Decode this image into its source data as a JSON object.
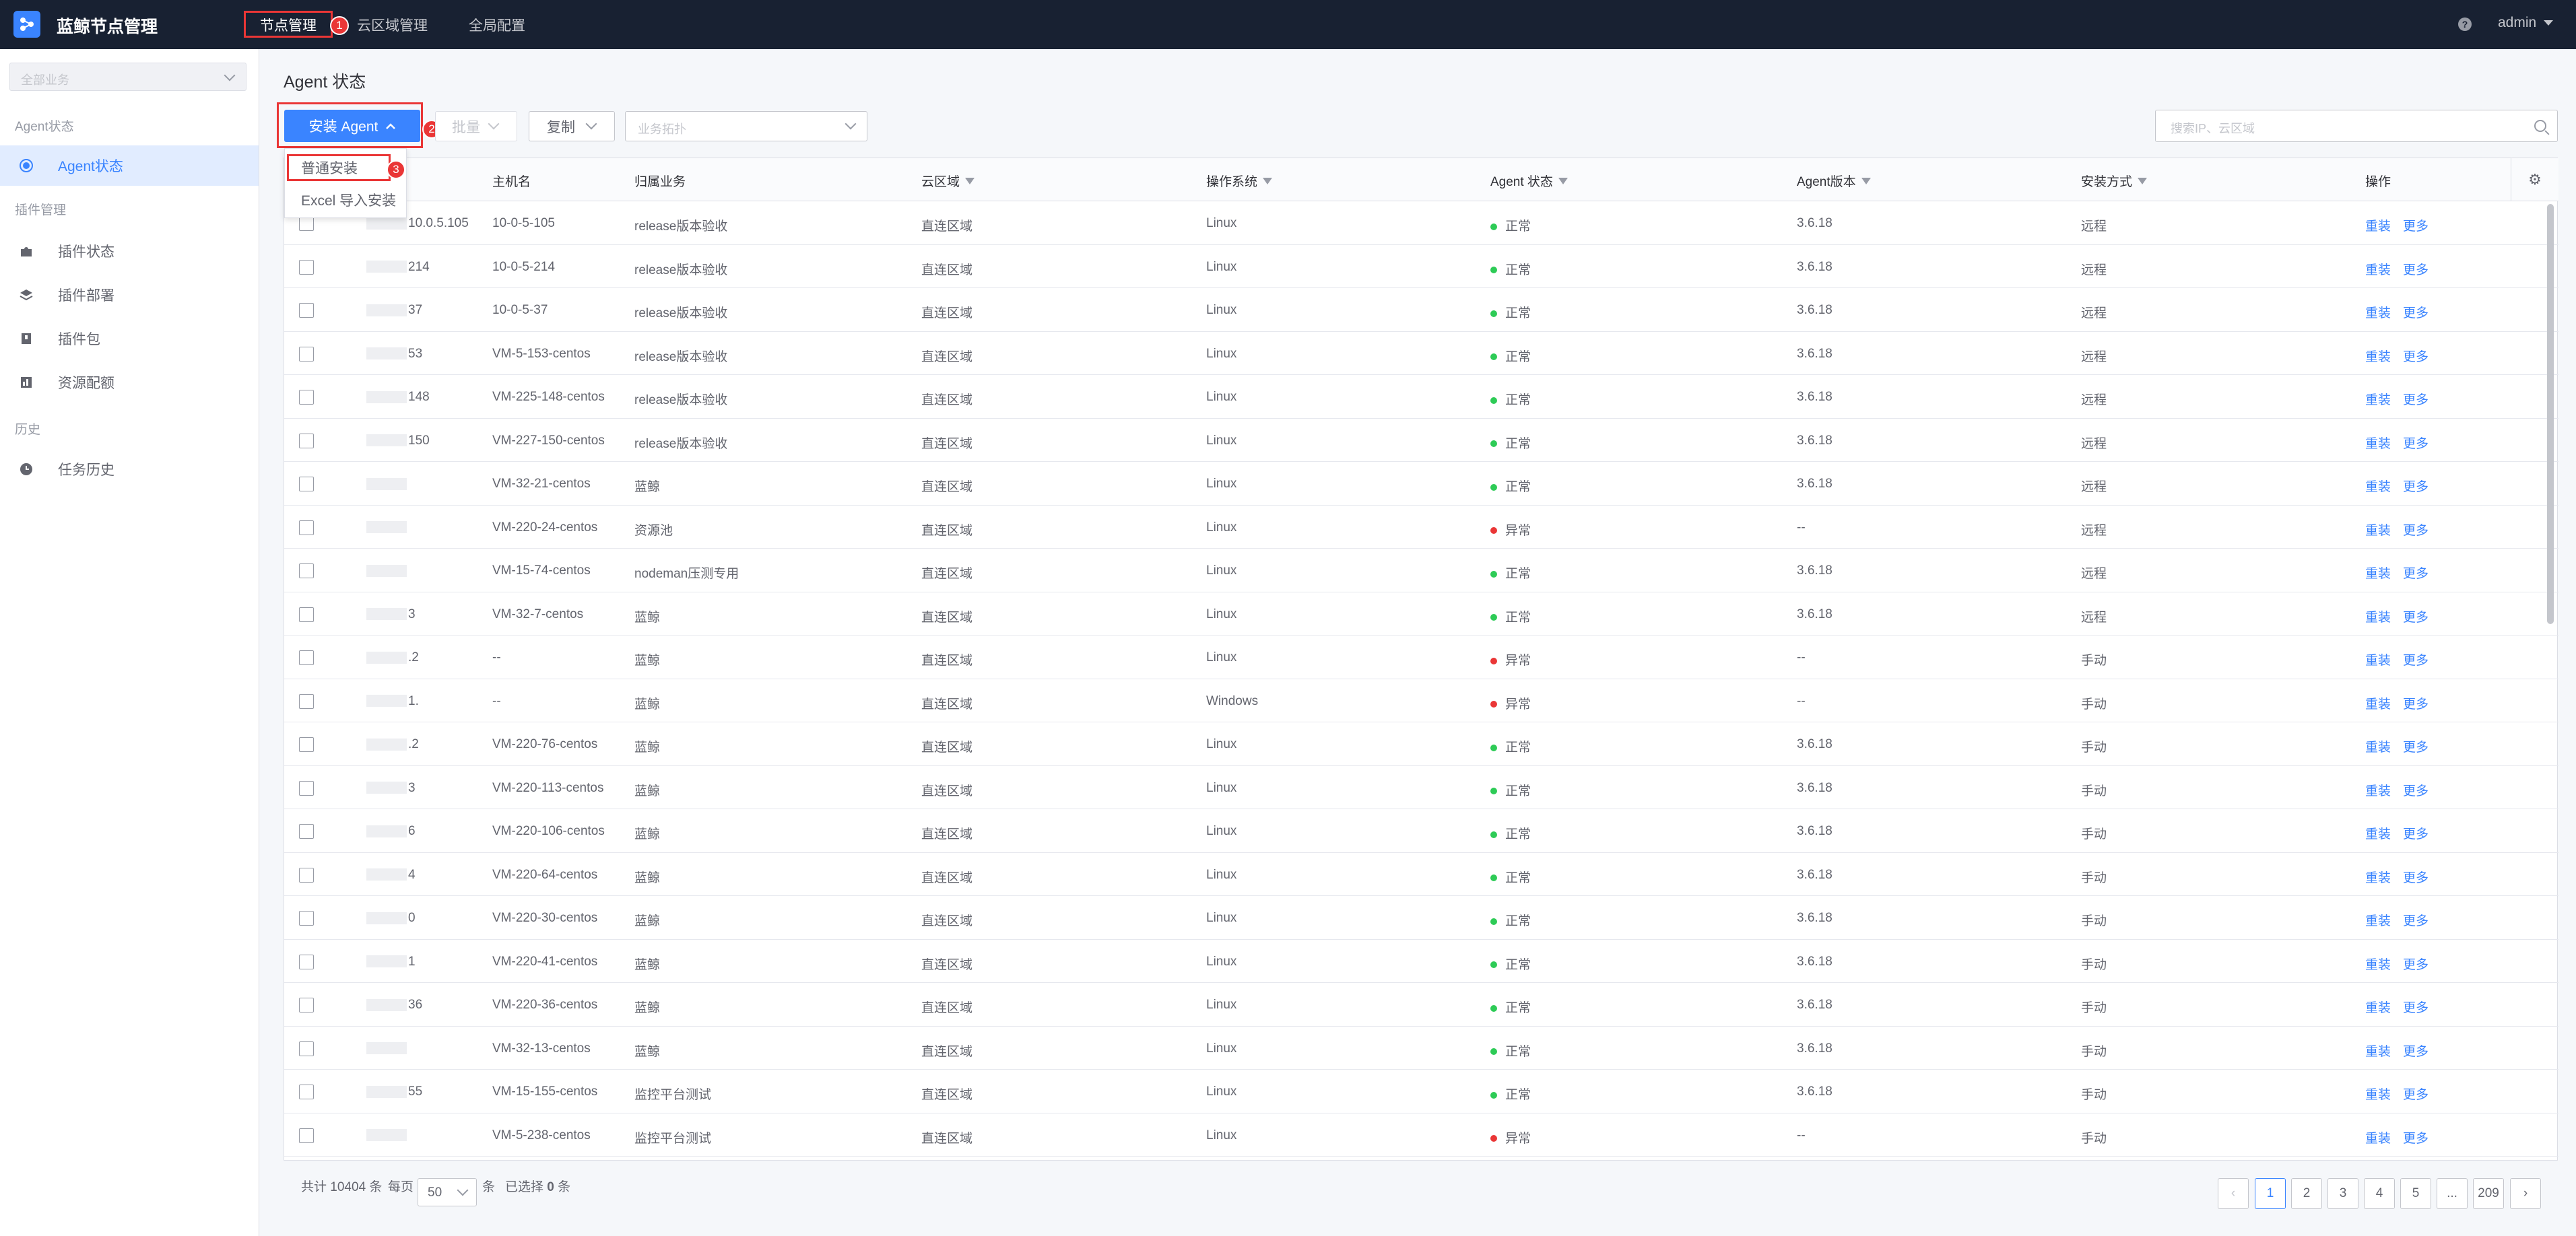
{
  "app": {
    "title": "蓝鲸节点管理"
  },
  "nav": {
    "items": [
      {
        "label": "节点管理"
      },
      {
        "label": "云区域管理"
      },
      {
        "label": "全局配置"
      }
    ],
    "user": "admin",
    "help": "?"
  },
  "annotations": {
    "b1": "1",
    "b2": "2",
    "b3": "3"
  },
  "sidebar": {
    "biz_placeholder": "全部业务",
    "group_agent": "Agent状态",
    "group_plugin": "插件管理",
    "group_history": "历史",
    "items": [
      {
        "label": "Agent状态",
        "icon": "radio-icon"
      },
      {
        "label": "插件状态",
        "icon": "puzzle-icon"
      },
      {
        "label": "插件部署",
        "icon": "layers-icon"
      },
      {
        "label": "插件包",
        "icon": "package-icon"
      },
      {
        "label": "资源配额",
        "icon": "quota-icon"
      },
      {
        "label": "任务历史",
        "icon": "clock-icon"
      }
    ]
  },
  "page": {
    "title": "Agent 状态"
  },
  "toolbar": {
    "install_label": "安装 Agent",
    "batch_label": "批量",
    "copy_label": "复制",
    "topo_placeholder": "业务拓扑",
    "search_placeholder": "搜索IP、云区域"
  },
  "install_menu": [
    "普通安装",
    "Excel 导入安装"
  ],
  "table": {
    "columns": [
      "主机名",
      "归属业务",
      "云区域",
      "操作系统",
      "Agent 状态",
      "Agent版本",
      "安装方式",
      "操作"
    ],
    "action_reinstall": "重装",
    "action_more": "更多",
    "rows": [
      {
        "ip_visible": "10.0.5.105",
        "host": "10-0-5-105",
        "biz": "release版本验收",
        "cloud": "直连区域",
        "os": "Linux",
        "status": "正常",
        "ok": true,
        "ver": "3.6.18",
        "method": "远程"
      },
      {
        "ip_visible": "214",
        "host": "10-0-5-214",
        "biz": "release版本验收",
        "cloud": "直连区域",
        "os": "Linux",
        "status": "正常",
        "ok": true,
        "ver": "3.6.18",
        "method": "远程"
      },
      {
        "ip_visible": "37",
        "host": "10-0-5-37",
        "biz": "release版本验收",
        "cloud": "直连区域",
        "os": "Linux",
        "status": "正常",
        "ok": true,
        "ver": "3.6.18",
        "method": "远程"
      },
      {
        "ip_visible": "53",
        "host": "VM-5-153-centos",
        "biz": "release版本验收",
        "cloud": "直连区域",
        "os": "Linux",
        "status": "正常",
        "ok": true,
        "ver": "3.6.18",
        "method": "远程"
      },
      {
        "ip_visible": "148",
        "host": "VM-225-148-centos",
        "biz": "release版本验收",
        "cloud": "直连区域",
        "os": "Linux",
        "status": "正常",
        "ok": true,
        "ver": "3.6.18",
        "method": "远程"
      },
      {
        "ip_visible": "150",
        "host": "VM-227-150-centos",
        "biz": "release版本验收",
        "cloud": "直连区域",
        "os": "Linux",
        "status": "正常",
        "ok": true,
        "ver": "3.6.18",
        "method": "远程"
      },
      {
        "ip_visible": "",
        "host": "VM-32-21-centos",
        "biz": "蓝鲸",
        "cloud": "直连区域",
        "os": "Linux",
        "status": "正常",
        "ok": true,
        "ver": "3.6.18",
        "method": "远程"
      },
      {
        "ip_visible": "",
        "host": "VM-220-24-centos",
        "biz": "资源池",
        "cloud": "直连区域",
        "os": "Linux",
        "status": "异常",
        "ok": false,
        "ver": "--",
        "method": "远程"
      },
      {
        "ip_visible": "",
        "host": "VM-15-74-centos",
        "biz": "nodeman压测专用",
        "cloud": "直连区域",
        "os": "Linux",
        "status": "正常",
        "ok": true,
        "ver": "3.6.18",
        "method": "远程"
      },
      {
        "ip_visible": "3",
        "host": "VM-32-7-centos",
        "biz": "蓝鲸",
        "cloud": "直连区域",
        "os": "Linux",
        "status": "正常",
        "ok": true,
        "ver": "3.6.18",
        "method": "远程"
      },
      {
        "ip_visible": ".2",
        "host": "--",
        "biz": "蓝鲸",
        "cloud": "直连区域",
        "os": "Linux",
        "status": "异常",
        "ok": false,
        "ver": "--",
        "method": "手动"
      },
      {
        "ip_visible": "1.",
        "host": "--",
        "biz": "蓝鲸",
        "cloud": "直连区域",
        "os": "Windows",
        "status": "异常",
        "ok": false,
        "ver": "--",
        "method": "手动"
      },
      {
        "ip_visible": ".2",
        "host": "VM-220-76-centos",
        "biz": "蓝鲸",
        "cloud": "直连区域",
        "os": "Linux",
        "status": "正常",
        "ok": true,
        "ver": "3.6.18",
        "method": "手动"
      },
      {
        "ip_visible": "3",
        "host": "VM-220-113-centos",
        "biz": "蓝鲸",
        "cloud": "直连区域",
        "os": "Linux",
        "status": "正常",
        "ok": true,
        "ver": "3.6.18",
        "method": "手动"
      },
      {
        "ip_visible": "6",
        "host": "VM-220-106-centos",
        "biz": "蓝鲸",
        "cloud": "直连区域",
        "os": "Linux",
        "status": "正常",
        "ok": true,
        "ver": "3.6.18",
        "method": "手动"
      },
      {
        "ip_visible": "4",
        "host": "VM-220-64-centos",
        "biz": "蓝鲸",
        "cloud": "直连区域",
        "os": "Linux",
        "status": "正常",
        "ok": true,
        "ver": "3.6.18",
        "method": "手动"
      },
      {
        "ip_visible": "0",
        "host": "VM-220-30-centos",
        "biz": "蓝鲸",
        "cloud": "直连区域",
        "os": "Linux",
        "status": "正常",
        "ok": true,
        "ver": "3.6.18",
        "method": "手动"
      },
      {
        "ip_visible": "1",
        "host": "VM-220-41-centos",
        "biz": "蓝鲸",
        "cloud": "直连区域",
        "os": "Linux",
        "status": "正常",
        "ok": true,
        "ver": "3.6.18",
        "method": "手动"
      },
      {
        "ip_visible": "36",
        "host": "VM-220-36-centos",
        "biz": "蓝鲸",
        "cloud": "直连区域",
        "os": "Linux",
        "status": "正常",
        "ok": true,
        "ver": "3.6.18",
        "method": "手动"
      },
      {
        "ip_visible": "",
        "host": "VM-32-13-centos",
        "biz": "蓝鲸",
        "cloud": "直连区域",
        "os": "Linux",
        "status": "正常",
        "ok": true,
        "ver": "3.6.18",
        "method": "手动"
      },
      {
        "ip_visible": "55",
        "host": "VM-15-155-centos",
        "biz": "监控平台测试",
        "cloud": "直连区域",
        "os": "Linux",
        "status": "正常",
        "ok": true,
        "ver": "3.6.18",
        "method": "手动"
      },
      {
        "ip_visible": "",
        "host": "VM-5-238-centos",
        "biz": "监控平台测试",
        "cloud": "直连区域",
        "os": "Linux",
        "status": "异常",
        "ok": false,
        "ver": "--",
        "method": "手动"
      }
    ]
  },
  "footer": {
    "total_prefix": "共计",
    "total": "10404",
    "total_unit": "条",
    "per_page_label": "每页",
    "per_page": "50",
    "per_page_unit": "条",
    "selected_prefix": "已选择",
    "selected": "0",
    "selected_unit": "条",
    "pages": [
      "1",
      "2",
      "3",
      "4",
      "5",
      "...",
      "209"
    ],
    "current_page": "1"
  },
  "colors": {
    "primary": "#3a84ff",
    "ok": "#2dcb56",
    "error": "#ea3636",
    "nav_bg": "#182132"
  }
}
